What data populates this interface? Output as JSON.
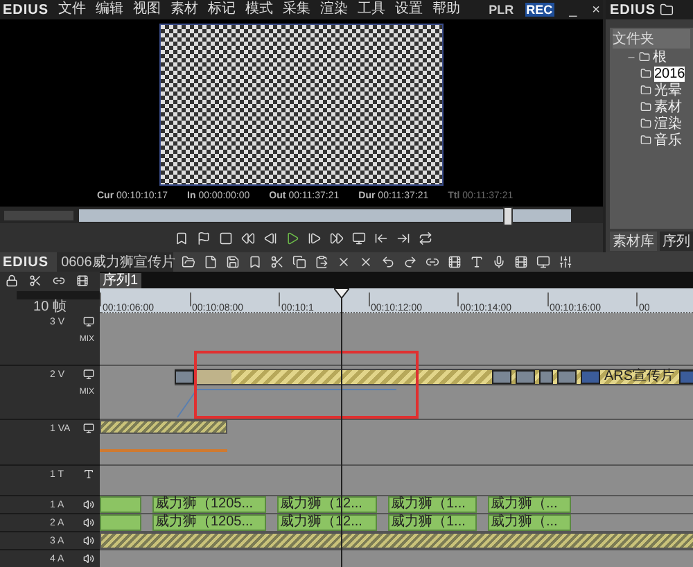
{
  "menu_bar": {
    "logo": "EDIUS",
    "items": [
      "文件",
      "编辑",
      "视图",
      "素材",
      "标记",
      "模式",
      "采集",
      "渲染",
      "工具",
      "设置",
      "帮助"
    ]
  },
  "player": {
    "modes": [
      {
        "label": "PLR",
        "selected": false
      },
      {
        "label": "REC",
        "selected": true
      }
    ],
    "minimize": "_",
    "close": "×",
    "timecodes": [
      {
        "label": "Cur",
        "value": "00:10:10:17",
        "dim": false
      },
      {
        "label": "In",
        "value": "00:00:00:00",
        "dim": false
      },
      {
        "label": "Out",
        "value": "00:11:37:21",
        "dim": false
      },
      {
        "label": "Dur",
        "value": "00:11:37:21",
        "dim": false
      },
      {
        "label": "Ttl",
        "value": "00:11:37:21",
        "dim": true
      }
    ],
    "scrub": {
      "level": 0.87
    }
  },
  "bin": {
    "logo": "EDIUS",
    "header": "文件夹",
    "tree": [
      {
        "label": "根",
        "expanded": true,
        "selected": false,
        "children": [
          {
            "label": "2016",
            "selected": true
          },
          {
            "label": "光晕",
            "selected": false
          },
          {
            "label": "素材",
            "selected": false
          },
          {
            "label": "渲染",
            "selected": false
          },
          {
            "label": "音乐",
            "selected": false
          }
        ]
      }
    ],
    "tabs": [
      {
        "label": "素材库",
        "selected": true
      },
      {
        "label": "序列",
        "selected": false
      }
    ]
  },
  "timeline": {
    "logo": "EDIUS",
    "project": "0606威力狮宣传片",
    "zoom": "10 帧",
    "sequence_tabs": [
      {
        "label": "序列1",
        "selected": true
      }
    ],
    "ruler": [
      "00:10:06:00",
      "00:10:08:00",
      "00:10:1",
      "00:10:12:00",
      "00:10:14:00",
      "00:10:16:00",
      "00"
    ],
    "tracks": [
      {
        "label": "3 V",
        "kind": "video",
        "mix": "MIX"
      },
      {
        "label": "2 V",
        "kind": "video",
        "mix": "MIX",
        "clips": [
          {
            "kind": "video",
            "text": "ARS宣传片"
          }
        ]
      },
      {
        "label": "1 VA",
        "kind": "va",
        "clips": [
          {
            "kind": "stripes"
          }
        ]
      },
      {
        "label": "1 T",
        "kind": "title"
      },
      {
        "label": "1 A",
        "kind": "audio",
        "clips": [
          {
            "kind": "audio"
          },
          {
            "kind": "gap"
          },
          {
            "kind": "audio",
            "text": "威力狮（1205..."
          },
          {
            "kind": "gap"
          },
          {
            "kind": "audio",
            "text": "威力狮（12..."
          },
          {
            "kind": "gap"
          },
          {
            "kind": "audio",
            "text": "威力狮（1..."
          },
          {
            "kind": "gap"
          },
          {
            "kind": "audio",
            "text": "威力狮（..."
          }
        ]
      },
      {
        "label": "2 A",
        "kind": "audio",
        "clips": [
          {
            "kind": "audio"
          },
          {
            "kind": "gap"
          },
          {
            "kind": "audio",
            "text": "威力狮（1205..."
          },
          {
            "kind": "gap"
          },
          {
            "kind": "audio",
            "text": "威力狮（12..."
          },
          {
            "kind": "gap"
          },
          {
            "kind": "audio",
            "text": "威力狮（1..."
          },
          {
            "kind": "gap"
          },
          {
            "kind": "audio",
            "text": "威力狮（..."
          }
        ]
      },
      {
        "label": "3 A",
        "kind": "audio",
        "clips": [
          {
            "kind": "stripes"
          }
        ]
      },
      {
        "label": "4 A",
        "kind": "audio"
      }
    ]
  }
}
